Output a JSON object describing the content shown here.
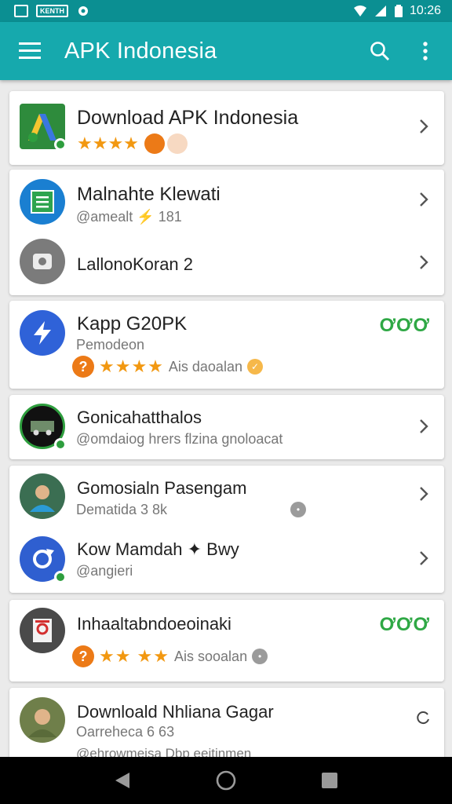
{
  "status_bar": {
    "time": "10:26",
    "pill_text": "KENTH"
  },
  "app_bar": {
    "title": "APK Indonesia",
    "menu_icon": "menu-icon",
    "search_icon": "search-icon",
    "more_icon": "more-vert-icon"
  },
  "colors": {
    "status": "#0b8f92",
    "appbar": "#16a9ad",
    "star": "#f29811",
    "green": "#2fa845",
    "badge": "#ec7a17"
  },
  "cards": [
    {
      "title": "Download APK Indonesia",
      "stars": "★★★★",
      "icon": "google-ads-icon"
    },
    {
      "rows": [
        {
          "title": "Malnahte Klewati",
          "sub": "@amealt ⚡ 181",
          "icon": "document-icon"
        },
        {
          "title": "LallonoKoran 2",
          "icon": "camera-icon"
        }
      ]
    },
    {
      "title": "Kapp G20PK",
      "sub": "Pemodeon",
      "rating_stars": "★★★★",
      "rating_text": "Ais daoalan",
      "mark": "ƠƠƠ",
      "icon": "bolt-icon"
    },
    {
      "title": "Gonicahatthalos",
      "sub": "@omdaiog hrers flzina gnoloacat",
      "icon": "truck-icon"
    },
    {
      "rows": [
        {
          "title": "Gomosialn Pasengam",
          "sub": "Dematida 3 8k",
          "icon": "person-icon"
        },
        {
          "title": "Kow Mamdah ✦ Bwy",
          "sub": "@angieri",
          "icon": "sync-icon"
        }
      ]
    },
    {
      "title": "Inhaaltabndoeoinaki",
      "rating_stars": "★★ ★★",
      "rating_text": "Ais sooalan",
      "mark": "ƠƠƠ",
      "icon": "recorder-icon"
    },
    {
      "title": "Downloald Nhliana Gagar",
      "sub": "Oarreheca 6 63",
      "sub2": "@ehrowmeisa Dbp eeitinmen",
      "icon": "avatar-icon"
    }
  ],
  "nav": {
    "back": "back-icon",
    "home": "home-icon",
    "recents": "recents-icon"
  }
}
